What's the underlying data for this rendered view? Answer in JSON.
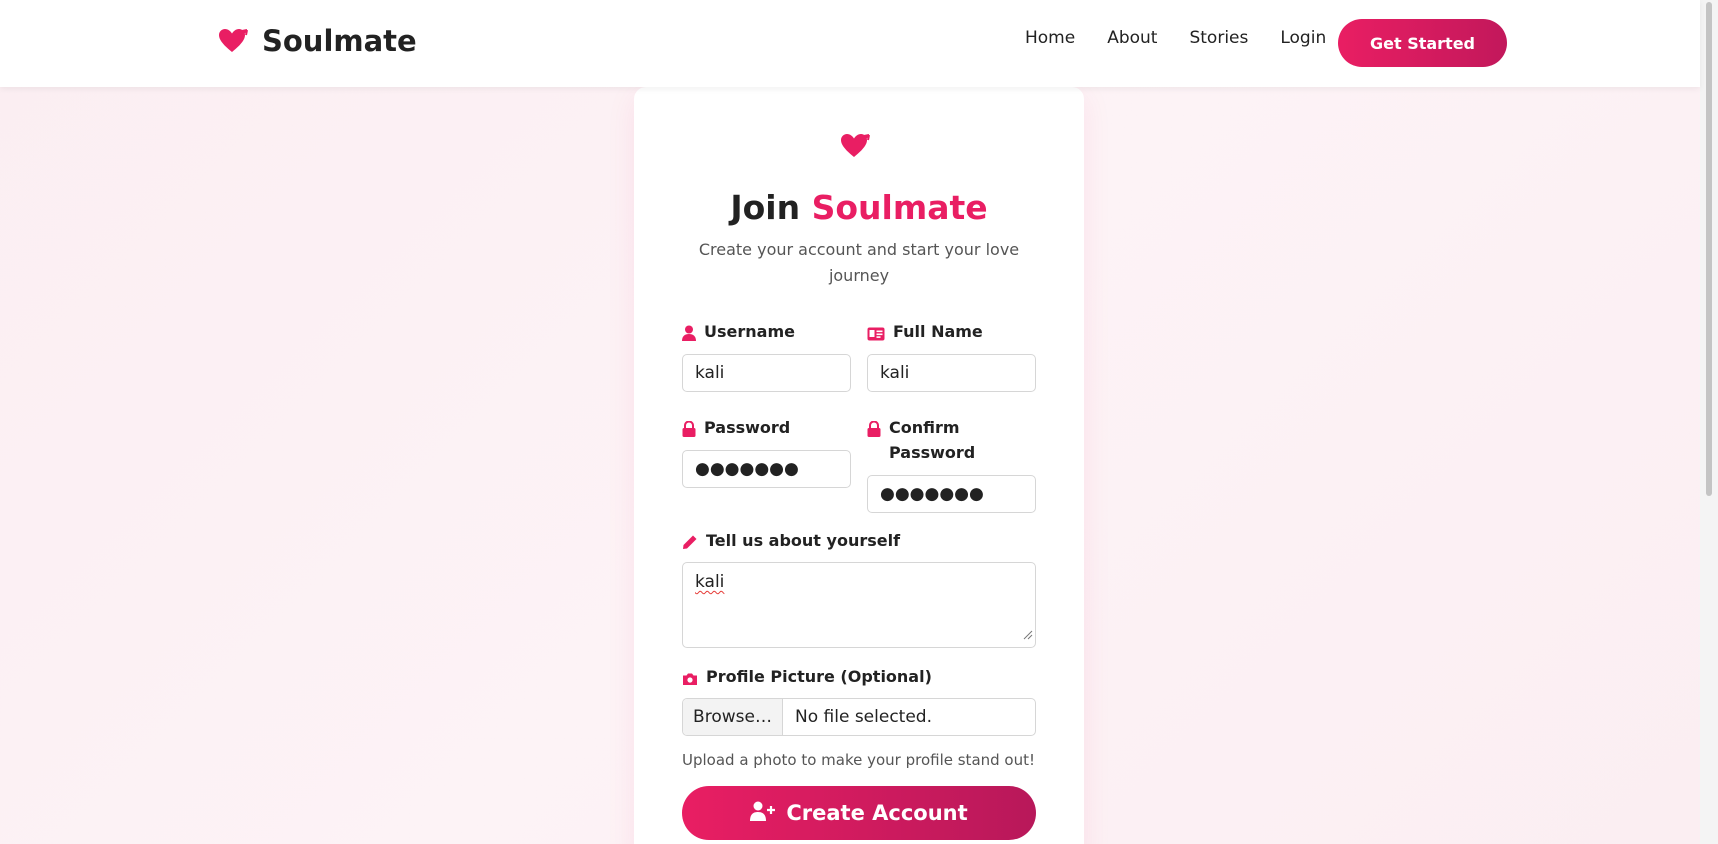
{
  "colors": {
    "accent": "#e91e63",
    "accent_dark": "#c2185b",
    "text": "#222222",
    "muted": "#555555"
  },
  "navbar": {
    "brand_icon": "heart-arrow-icon",
    "brand_name": "Soulmate",
    "links": [
      "Home",
      "About",
      "Stories",
      "Login"
    ],
    "cta_label": "Get Started"
  },
  "form": {
    "title_prefix": "Join",
    "title_accent": "Soulmate",
    "subtitle": "Create your account and start your love journey",
    "username": {
      "icon": "user-icon",
      "label": "Username",
      "value": "kali"
    },
    "fullname": {
      "icon": "id-card-icon",
      "label": "Full Name",
      "value": "kali"
    },
    "password": {
      "icon": "lock-icon",
      "label": "Password",
      "value": "●●●●●●●"
    },
    "confirm_password": {
      "icon": "lock-icon",
      "label": "Confirm Password",
      "value": "●●●●●●●"
    },
    "bio": {
      "icon": "pencil-icon",
      "label": "Tell us about yourself",
      "value": "kali"
    },
    "profile_picture": {
      "icon": "camera-icon",
      "label": "Profile Picture (Optional)",
      "browse_label": "Browse…",
      "file_status": "No file selected.",
      "help": "Upload a photo to make your profile stand out!"
    },
    "submit_icon": "user-plus-icon",
    "submit_label": "Create Account"
  }
}
